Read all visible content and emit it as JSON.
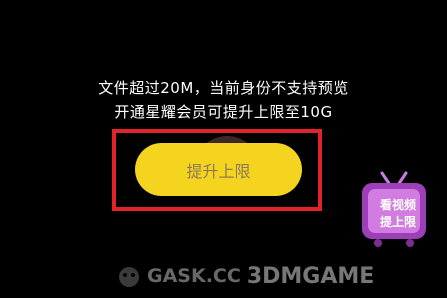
{
  "message": {
    "line1": "文件超过20M，当前身份不支持预览",
    "line2": "开通星耀会员可提升上限至10G"
  },
  "upgrade_button": {
    "label": "提升上限"
  },
  "promo_badge": {
    "line1": "看视频",
    "line2": "提上限"
  },
  "watermark": {
    "left": "GASK.CC",
    "right": "3DMGAME"
  },
  "colors": {
    "background": "#000000",
    "button": "#f5d420",
    "highlight": "#e2232a",
    "badge": "#b050c8"
  }
}
